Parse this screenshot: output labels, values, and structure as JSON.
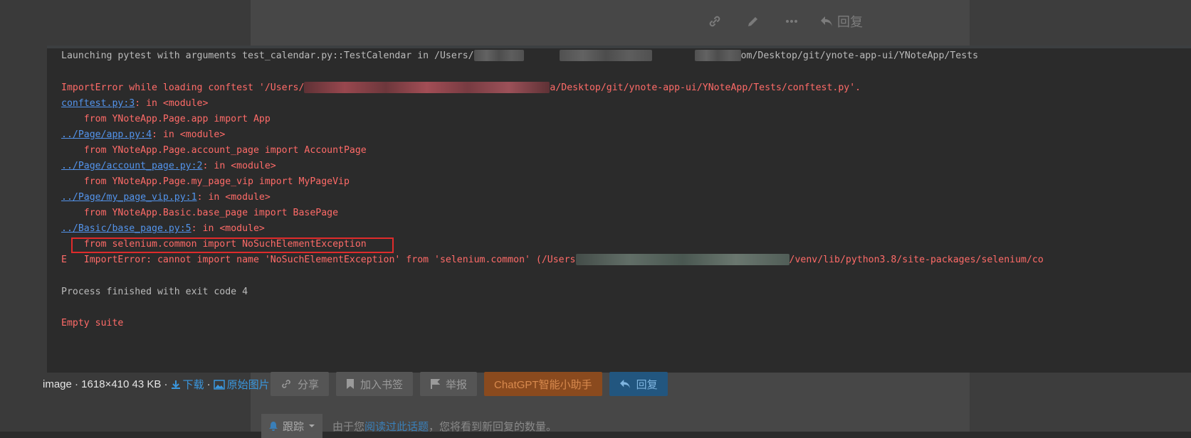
{
  "top_actions": {
    "reply_label": "回复"
  },
  "terminal": {
    "launch_line": {
      "prefix": "Launching pytest with arguments test_calendar.py::TestCalendar in /Users/",
      "suffix": "om/Desktop/git/ynote-app-ui/YNoteApp/Tests"
    },
    "import_error_line": {
      "prefix": "ImportError while loading conftest '/Users/",
      "suffix": "a/Desktop/git/ynote-app-ui/YNoteApp/Tests/conftest.py'."
    },
    "traceback": [
      {
        "link": "conftest.py:3",
        "in": ": in <module>",
        "code": "    from YNoteApp.Page.app import App"
      },
      {
        "link": "../Page/app.py:4",
        "in": ": in <module>",
        "code": "    from YNoteApp.Page.account_page import AccountPage"
      },
      {
        "link": "../Page/account_page.py:2",
        "in": ": in <module>",
        "code": "    from YNoteApp.Page.my_page_vip import MyPageVip"
      },
      {
        "link": "../Page/my_page_vip.py:1",
        "in": ": in <module>",
        "code": "    from YNoteApp.Basic.base_page import BasePage"
      },
      {
        "link": "../Basic/base_page.py:5",
        "in": ": in <module>",
        "code": "    from selenium.common import NoSuchElementException"
      }
    ],
    "e_line": {
      "prefix": "E   ImportError: cannot import name 'NoSuchElementException' from 'selenium.common' (/Users",
      "suffix": "/venv/lib/python3.8/site-packages/selenium/co"
    },
    "process_line": "Process finished with exit code 4",
    "empty_suite": "Empty suite"
  },
  "caption": {
    "text": "image · 1618×410 43 KB ·",
    "download": "下载",
    "sep": "·",
    "original": "原始图片"
  },
  "post_buttons": {
    "share": "分享",
    "bookmark": "加入书签",
    "report": "举报",
    "chatgpt": "ChatGPT智能小助手",
    "reply": "回复"
  },
  "follow": {
    "label": "跟踪",
    "text_prefix": "由于您",
    "link": "阅读过此话题",
    "text_suffix": "，您将看到新回复的数量。"
  },
  "colors": {
    "terminal_bg": "#2b2b2b",
    "error_red": "#ff6b68",
    "link_blue": "#5394ec",
    "highlight_box": "#e02b2b"
  }
}
